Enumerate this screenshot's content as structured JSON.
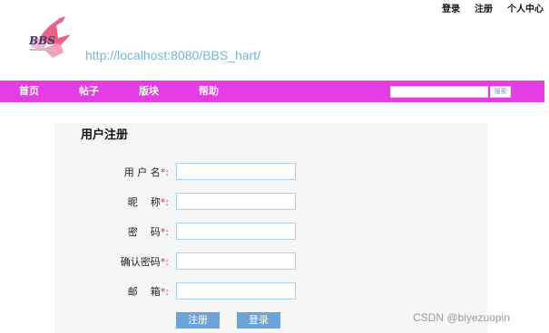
{
  "top_links": [
    "登录",
    "注册",
    "个人中心"
  ],
  "site_url": "http://localhost:8080/BBS_hart/",
  "nav": {
    "items": [
      "首页",
      "帖子",
      "版块",
      "帮助"
    ],
    "search_button": "搜索",
    "search_value": ""
  },
  "form": {
    "title": "用户注册",
    "fields": [
      {
        "label": "用 户 名",
        "required": "*:",
        "value": ""
      },
      {
        "label": "昵    称",
        "required": "*:",
        "value": ""
      },
      {
        "label": "密    码",
        "required": "*:",
        "value": ""
      },
      {
        "label": "确认密码",
        "required": "*:",
        "value": ""
      },
      {
        "label": "邮    箱",
        "required": "*:",
        "value": ""
      }
    ],
    "register_button": "注册",
    "login_button": "登录"
  },
  "watermark": "CSDN @biyezuopin",
  "colors": {
    "navbar": "#e63ce6",
    "url_text": "#6fb6d6",
    "button": "#6ea3d7",
    "required_mark": "#e03030"
  }
}
